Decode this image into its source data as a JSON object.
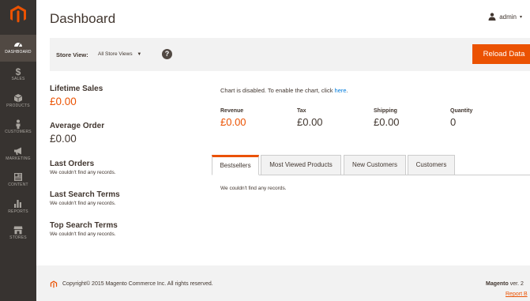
{
  "sidebar": {
    "items": [
      {
        "label": "DASHBOARD",
        "icon": "dashboard-icon"
      },
      {
        "label": "SALES",
        "icon": "dollar-icon"
      },
      {
        "label": "PRODUCTS",
        "icon": "box-icon"
      },
      {
        "label": "CUSTOMERS",
        "icon": "person-icon"
      },
      {
        "label": "MARKETING",
        "icon": "megaphone-icon"
      },
      {
        "label": "CONTENT",
        "icon": "layout-icon"
      },
      {
        "label": "REPORTS",
        "icon": "bar-chart-icon"
      },
      {
        "label": "STORES",
        "icon": "store-icon"
      }
    ]
  },
  "header": {
    "title": "Dashboard",
    "user": "admin"
  },
  "toolbar": {
    "store_view_label": "Store View:",
    "store_view_value": "All Store Views",
    "help": "?",
    "reload_label": "Reload Data"
  },
  "stats": {
    "lifetime_sales": {
      "label": "Lifetime Sales",
      "value": "£0.00"
    },
    "average_order": {
      "label": "Average Order",
      "value": "£0.00"
    },
    "last_orders": {
      "label": "Last Orders",
      "note": "We couldn't find any records."
    },
    "last_search": {
      "label": "Last Search Terms",
      "note": "We couldn't find any records."
    },
    "top_search": {
      "label": "Top Search Terms",
      "note": "We couldn't find any records."
    }
  },
  "chart": {
    "message": "Chart is disabled. To enable the chart, click ",
    "link": "here",
    "suffix": "."
  },
  "totals": {
    "revenue": {
      "label": "Revenue",
      "value": "£0.00"
    },
    "tax": {
      "label": "Tax",
      "value": "£0.00"
    },
    "shipping": {
      "label": "Shipping",
      "value": "£0.00"
    },
    "quantity": {
      "label": "Quantity",
      "value": "0"
    }
  },
  "tabs": [
    "Bestsellers",
    "Most Viewed Products",
    "New Customers",
    "Customers"
  ],
  "tab_content": "We couldn't find any records.",
  "footer": {
    "copyright": "Copyright© 2015 Magento Commerce Inc. All rights reserved.",
    "brand": "Magento",
    "version": " ver. 2",
    "report": "Report B"
  },
  "colors": {
    "accent": "#eb5202",
    "sidebar": "#373330",
    "link": "#007bdb"
  }
}
